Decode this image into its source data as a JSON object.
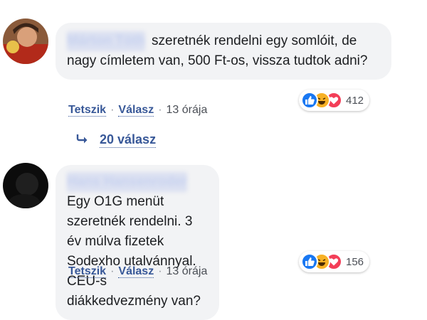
{
  "comments": [
    {
      "author": "Márton Tóth",
      "text": "szeretnék rendelni egy somlóit, de nagy címletem van, 500 Ft-os, vissza tudtok adni?",
      "actions": {
        "like": "Tetszik",
        "reply": "Válasz",
        "time": "13 órája"
      },
      "reaction_count": "412",
      "reactions": [
        "like",
        "haha",
        "love"
      ]
    },
    {
      "author": "Hans Hansenroder",
      "text": "Egy O1G menüt szeretnék rendelni. 3 év múlva fizetek Sodexho utalvánnyal. CEU-s diákkedvezmény van?",
      "actions": {
        "like": "Tetszik",
        "reply": "Válasz",
        "time": "13 órája"
      },
      "reaction_count": "156",
      "reactions": [
        "like",
        "haha",
        "love"
      ]
    }
  ],
  "replies_link": "20 válasz",
  "colors": {
    "link": "#385898",
    "bubble": "#f2f3f5",
    "like": "#1877f2",
    "haha": "#f7b125",
    "love": "#f33e58"
  }
}
